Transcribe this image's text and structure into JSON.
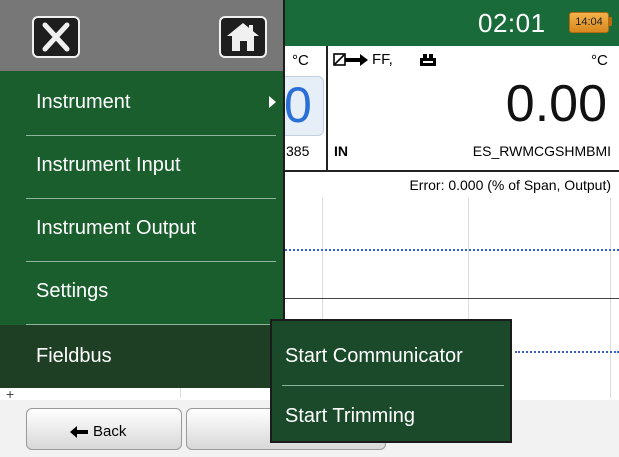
{
  "status_bar": {
    "time": "02:01",
    "battery_text": "14:04",
    "colors": {
      "bar": "#1a6b3a",
      "battery": "#f3b24a"
    }
  },
  "left_readout": {
    "unit": "°C",
    "value": "0",
    "id": "385"
  },
  "right_readout": {
    "protocol": "FF,",
    "unit": "°C",
    "value": "0.00",
    "channel": "IN",
    "tag": "ES_RWMCGSHMBMI",
    "icons": [
      "instrument-arrow-icon",
      "instrument-icon"
    ]
  },
  "graph": {
    "title": "Error: 0.000 (% of Span, Output)",
    "cursor_mark": "+"
  },
  "bottom_bar": {
    "back_label": "Back",
    "back_icon": "left-arrow-icon"
  },
  "menu": {
    "header_icons": [
      "close-icon",
      "home-icon"
    ],
    "items": [
      {
        "label": "Instrument",
        "has_submenu": true
      },
      {
        "label": "Instrument Input"
      },
      {
        "label": "Instrument Output"
      },
      {
        "label": "Settings"
      },
      {
        "label": "Fieldbus",
        "selected": true
      }
    ],
    "colors": {
      "panel": "#1a5e2e",
      "header": "#777777",
      "selected": "#1f3f24"
    }
  },
  "submenu": {
    "items": [
      {
        "label": "Start Communicator"
      },
      {
        "label": "Start Trimming"
      }
    ]
  }
}
